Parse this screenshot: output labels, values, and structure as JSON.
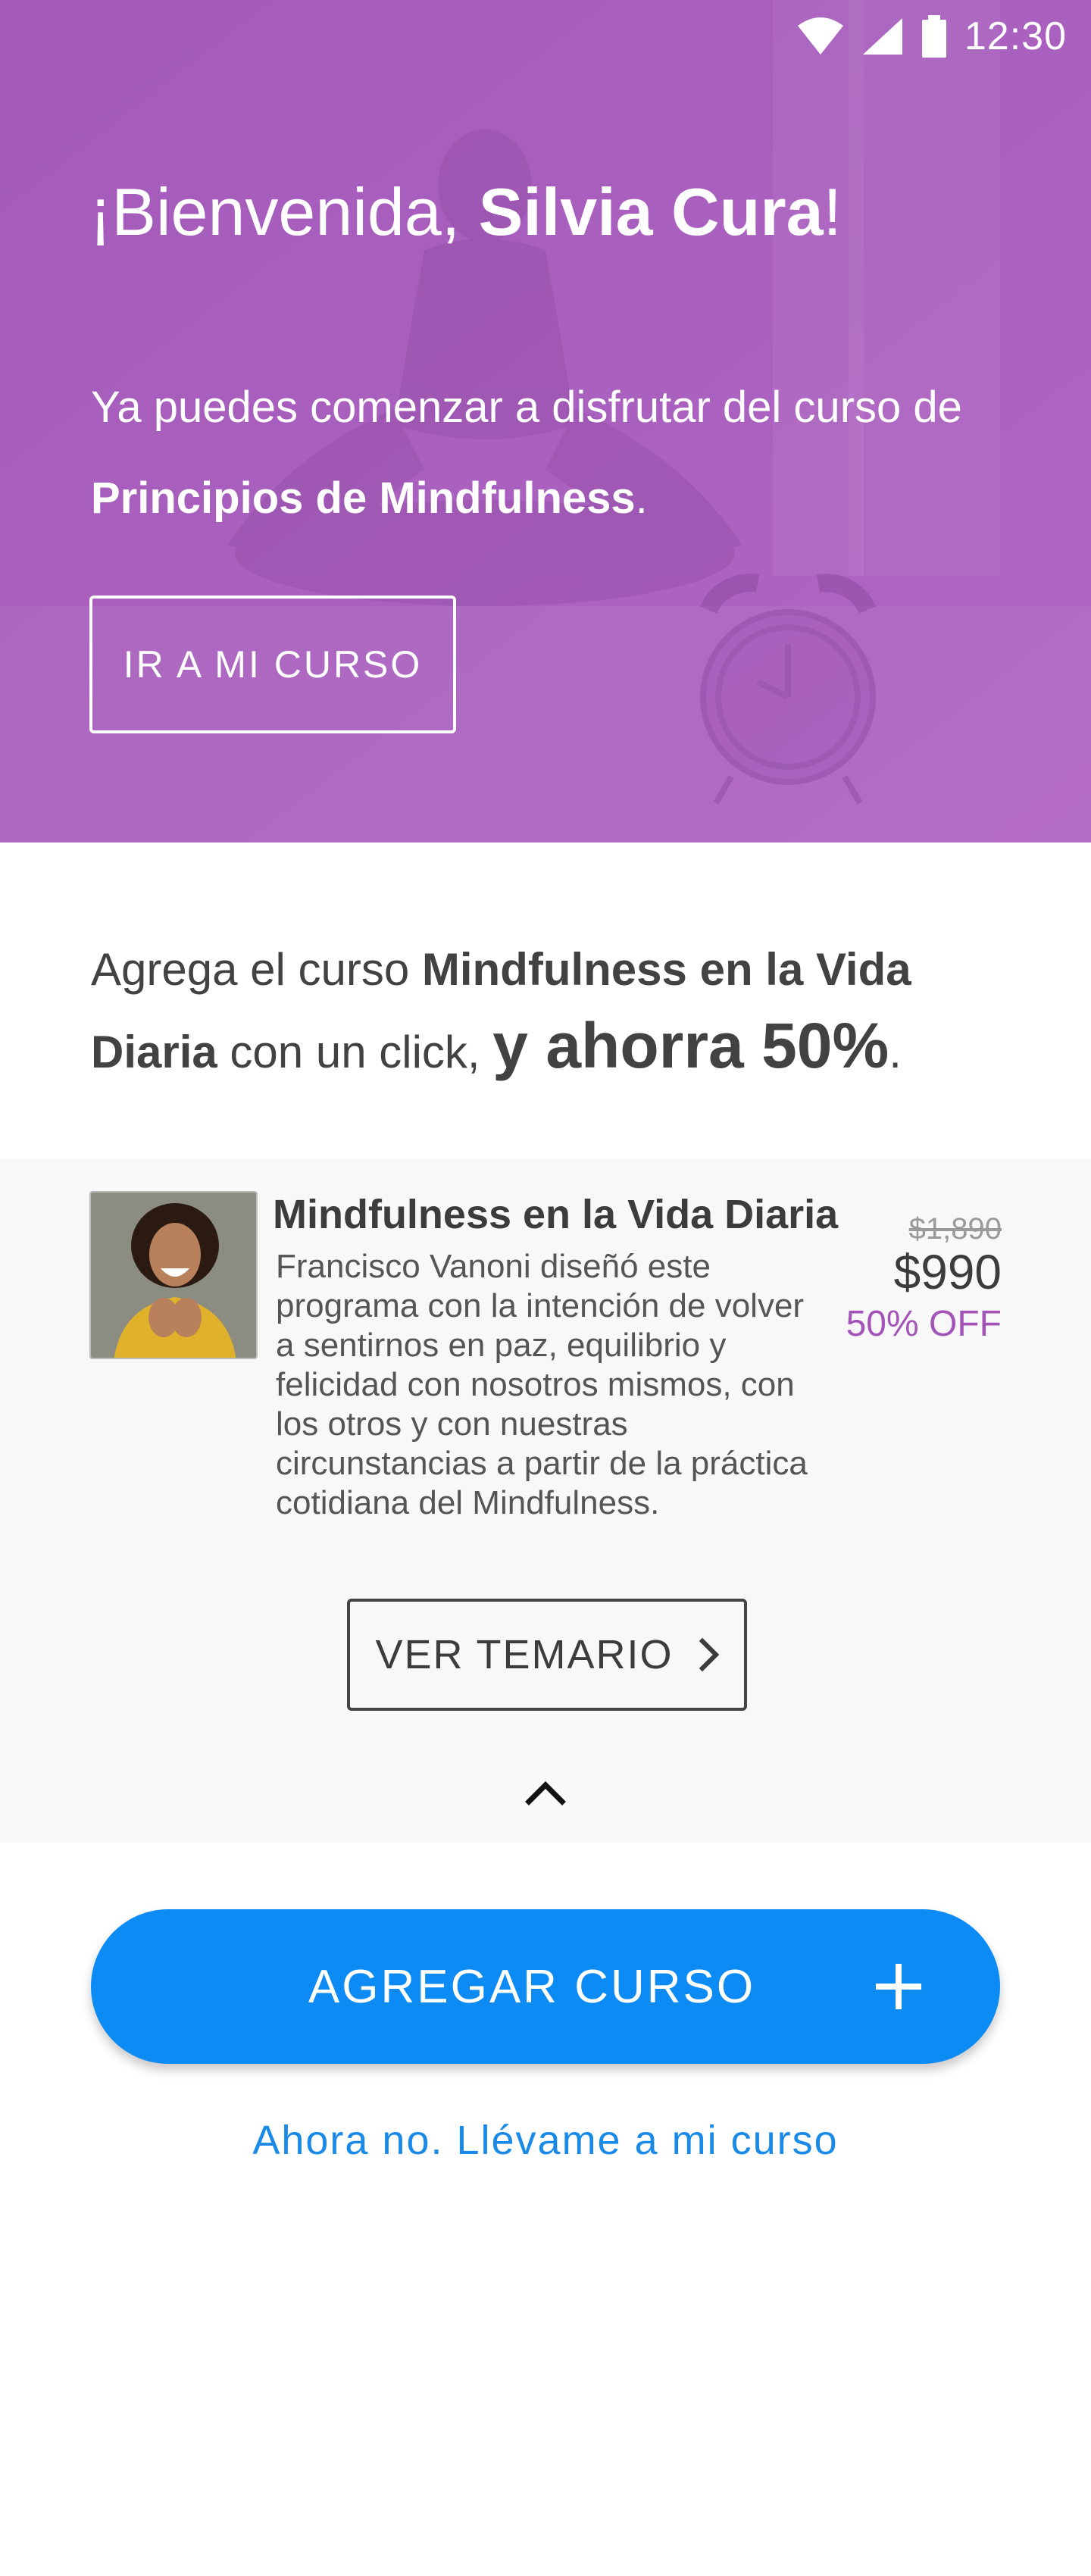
{
  "status_bar": {
    "time": "12:30",
    "icons": [
      "wifi-icon",
      "signal-icon",
      "battery-icon"
    ]
  },
  "hero": {
    "greeting_prefix": "¡Bienvenida, ",
    "user_name": "Silvia Cura",
    "greeting_suffix": "!",
    "intro_line": "Ya puedes comenzar a disfrutar del curso de ",
    "course_name": "Principios de Mindfulness",
    "intro_end": ".",
    "button_label": "IR A MI CURSO",
    "accent_color": "#a95bbf"
  },
  "promo": {
    "text_prefix": "Agrega el curso ",
    "course_name": "Mindfulness en la Vida Diaria",
    "text_middle": " con un click, ",
    "highlight": "y ahorra 50%",
    "text_end": "."
  },
  "course": {
    "title": "Mindfulness en la Vida Diaria",
    "description": "Francisco Vanoni diseñó este programa con la intención de volver a sentirnos en paz, equilibrio y felicidad con nosotros mismos, con los otros y con nuestras circunstancias a partir de la práctica cotidiana del Mindfulness.",
    "price_old": "$1,890",
    "price_new": "$990",
    "discount": "50% OFF",
    "syllabus_button": "VER TEMARIO",
    "discount_color": "#a453b9"
  },
  "actions": {
    "add_button": "AGREGAR CURSO",
    "skip_link": "Ahora no. Llévame a mi curso",
    "primary_color": "#0d8bf5"
  }
}
